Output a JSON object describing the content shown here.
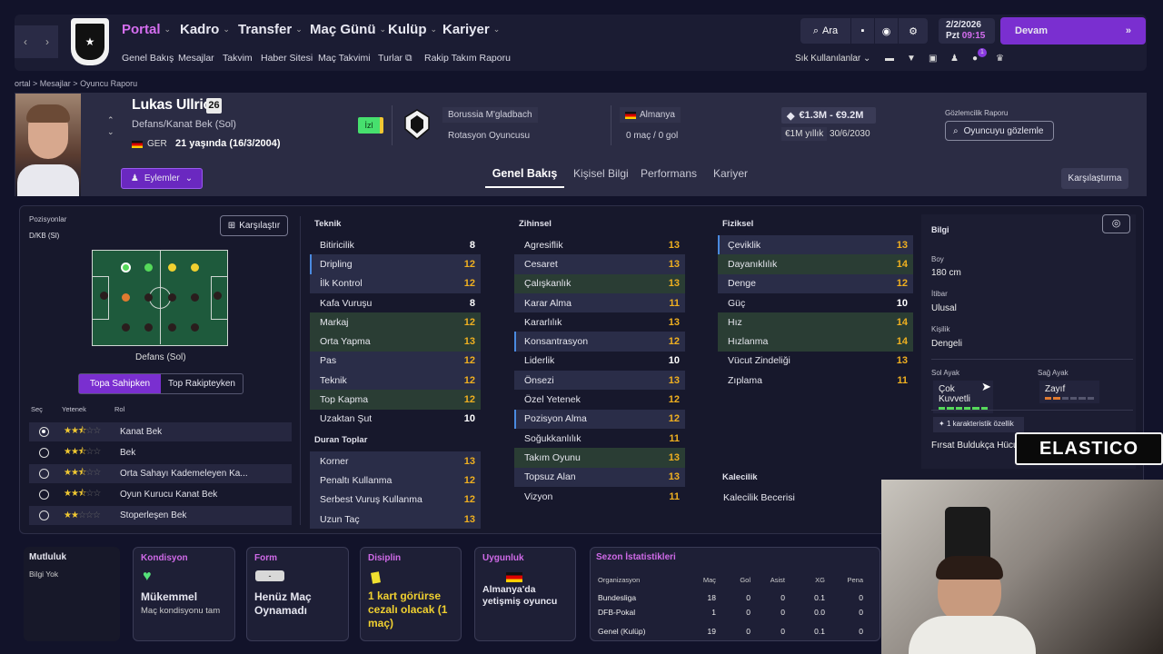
{
  "nav": {
    "menus": [
      "Portal",
      "Kadro",
      "Transfer",
      "Maç Günü",
      "Kulüp",
      "Kariyer"
    ],
    "submenus": [
      "Genel Bakış",
      "Mesajlar",
      "Takvim",
      "Haber Sitesi",
      "Maç Takvimi",
      "Turlar",
      "Rakip Takım Raporu"
    ],
    "search_label": "Ara",
    "date": "2/2/2026",
    "day": "Pzt",
    "time": "09:15",
    "continue_label": "Devam",
    "shortcuts_label": "Sık Kullanılanlar",
    "notification_count": "1"
  },
  "breadcrumb": [
    "ortal",
    "Mesajlar",
    "Oyuncu Raporu"
  ],
  "player": {
    "name": "Lukas Ullrich",
    "number": "26",
    "position": "Defans/Kanat Bek (Sol)",
    "nationality": "GER",
    "age": "21 yaşında (16/3/2004)",
    "actions_label": "Eylemler",
    "status_badge": "İzl",
    "club": "Borussia M'gladbach",
    "squad_status": "Rotasyon Oyuncusu",
    "country": "Almanya",
    "apps_goals": "0 maç / 0 gol",
    "value": "€1.3M - €9.2M",
    "wage": "€1M yıllık",
    "contract_end": "30/6/2030",
    "scout_label": "Gözlemcilik Raporu",
    "scout_button": "Oyuncuyu gözlemle"
  },
  "tabs": [
    "Genel Bakış",
    "Kişisel Bilgi",
    "Performans",
    "Kariyer"
  ],
  "compare_label": "Karşılaştırma",
  "positions": {
    "label": "Pozisyonlar",
    "value": "D/KB (Sl)",
    "compare": "Karşılaştır",
    "pitch_label": "Defans (Sol)",
    "toggle": [
      "Topa Sahipken",
      "Top Rakipteyken"
    ],
    "headers": [
      "Seç",
      "Yetenek",
      "Rol"
    ],
    "roles": [
      {
        "name": "Kanat Bek",
        "stars": 2.5,
        "selected": true
      },
      {
        "name": "Bek",
        "stars": 2.5,
        "selected": false
      },
      {
        "name": "Orta Sahayı Kademeleyen Ka...",
        "stars": 2.5,
        "selected": false
      },
      {
        "name": "Oyun Kurucu Kanat Bek",
        "stars": 2.5,
        "selected": false
      },
      {
        "name": "Stoperleşen Bek",
        "stars": 2,
        "selected": false
      }
    ]
  },
  "attributes": {
    "teknik_title": "Teknik",
    "teknik": [
      [
        "Bitiricilik",
        "8"
      ],
      [
        "Dripling",
        "12"
      ],
      [
        "İlk Kontrol",
        "12"
      ],
      [
        "Kafa Vuruşu",
        "8"
      ],
      [
        "Markaj",
        "12"
      ],
      [
        "Orta Yapma",
        "13"
      ],
      [
        "Pas",
        "12"
      ],
      [
        "Teknik",
        "12"
      ],
      [
        "Top Kapma",
        "12"
      ],
      [
        "Uzaktan Şut",
        "10"
      ]
    ],
    "duran_title": "Duran Toplar",
    "duran": [
      [
        "Korner",
        "13"
      ],
      [
        "Penaltı Kullanma",
        "12"
      ],
      [
        "Serbest Vuruş Kullanma",
        "12"
      ],
      [
        "Uzun Taç",
        "13"
      ]
    ],
    "zihinsel_title": "Zihinsel",
    "zihinsel": [
      [
        "Agresiflik",
        "13"
      ],
      [
        "Cesaret",
        "13"
      ],
      [
        "Çalışkanlık",
        "13"
      ],
      [
        "Karar Alma",
        "11"
      ],
      [
        "Kararlılık",
        "13"
      ],
      [
        "Konsantrasyon",
        "12"
      ],
      [
        "Liderlik",
        "10"
      ],
      [
        "Önsezi",
        "13"
      ],
      [
        "Özel Yetenek",
        "12"
      ],
      [
        "Pozisyon Alma",
        "12"
      ],
      [
        "Soğukkanlılık",
        "11"
      ],
      [
        "Takım Oyunu",
        "13"
      ],
      [
        "Topsuz Alan",
        "13"
      ],
      [
        "Vizyon",
        "11"
      ]
    ],
    "fiziksel_title": "Fiziksel",
    "fiziksel": [
      [
        "Çeviklik",
        "13"
      ],
      [
        "Dayanıklılık",
        "14"
      ],
      [
        "Denge",
        "12"
      ],
      [
        "Güç",
        "10"
      ],
      [
        "Hız",
        "14"
      ],
      [
        "Hızlanma",
        "14"
      ],
      [
        "Vücut Zindeliği",
        "13"
      ],
      [
        "Zıplama",
        "11"
      ]
    ],
    "kalecilik_title": "Kalecilik",
    "kalecilik_item": "Kalecilik Becerisi"
  },
  "info": {
    "title": "Bilgi",
    "height_label": "Boy",
    "height": "180 cm",
    "rep_label": "İtibar",
    "rep": "Ulusal",
    "personality_label": "Kişilik",
    "personality": "Dengeli",
    "left_foot_label": "Sol Ayak",
    "left_foot": "Çok Kuvvetli",
    "right_foot_label": "Sağ Ayak",
    "right_foot": "Zayıf",
    "traits_label": "1 karakteristik özellik",
    "trait": "Fırsat Buldukça Hücu"
  },
  "bottom": {
    "mutluluk": "Mutluluk",
    "mutluluk_val": "Bilgi Yok",
    "kondisyon": "Kondisyon",
    "kondisyon_val": "Mükemmel",
    "kondisyon_sub": "Maç kondisyonu tam",
    "form": "Form",
    "form_badge": "-",
    "form_val": "Henüz Maç Oynamadı",
    "disiplin": "Disiplin",
    "disiplin_val": "1 kart görürse cezalı olacak (1 maç)",
    "uygunluk": "Uygunluk",
    "uygunluk_val": "Almanya'da yetişmiş oyuncu",
    "stats_title": "Sezon İstatistikleri",
    "stats_headers": [
      "Organizasyon",
      "Maç",
      "Gol",
      "Asist",
      "XG",
      "Pena"
    ],
    "stats_rows": [
      [
        "Bundesliga",
        "18",
        "0",
        "0",
        "0.1",
        "0"
      ],
      [
        "DFB-Pokal",
        "1",
        "0",
        "0",
        "0.0",
        "0"
      ],
      [
        "Genel (Kulüp)",
        "19",
        "0",
        "0",
        "0.1",
        "0"
      ]
    ]
  },
  "overlay": {
    "brand": "ELASTICO"
  }
}
